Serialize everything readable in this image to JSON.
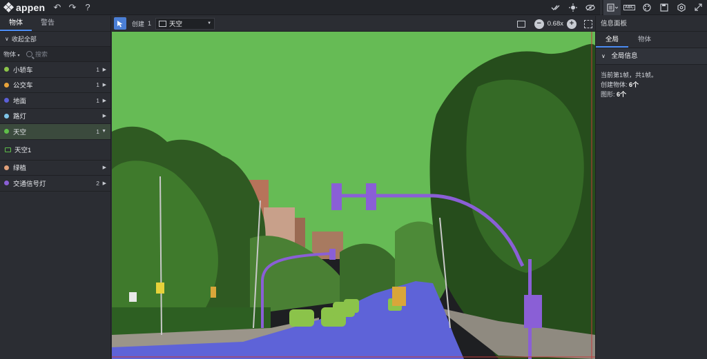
{
  "app": {
    "brand": "appen"
  },
  "topbar": {
    "undo": "↶",
    "redo": "↷",
    "help": "?",
    "right_icons": [
      "check-all-icon",
      "target-icon",
      "eye-icon",
      "layout-icon",
      "abc-icon",
      "palette-icon",
      "save-icon",
      "settings-icon",
      "expand-icon"
    ],
    "abc_label": "ABC"
  },
  "left": {
    "tabs": [
      {
        "label": "物体"
      },
      {
        "label": "警告"
      }
    ],
    "collapse_all": "收起全部",
    "filter_select": "物体",
    "search_placeholder": "搜索",
    "classes": [
      {
        "name": "小轿车",
        "color": "#8bc34a",
        "count": "1"
      },
      {
        "name": "公交车",
        "color": "#e8a33a",
        "count": "1"
      },
      {
        "name": "地面",
        "color": "#5b5fd6",
        "count": "1"
      },
      {
        "name": "路灯",
        "color": "#7fc4e8",
        "count": ""
      },
      {
        "name": "天空",
        "color": "#5fbf4a",
        "count": "1"
      },
      {
        "name": "绿植",
        "color": "#e0a07a",
        "count": ""
      },
      {
        "name": "交通信号灯",
        "color": "#8a5fd6",
        "count": "2"
      }
    ],
    "expanded_object": "天空1"
  },
  "canvasbar": {
    "create_label": "创建",
    "create_num": "1",
    "class_selected": "天空",
    "zoom": "0.68x",
    "zoom_minus": "−",
    "zoom_plus": "+"
  },
  "right": {
    "title": "信息面板",
    "tabs": [
      {
        "label": "全局"
      },
      {
        "label": "物体"
      }
    ],
    "section": "全局信息",
    "frame_text": "当前第1帧，共1帧。",
    "objects_label": "创建物体:",
    "objects_value": "6个",
    "shapes_label": "图形:",
    "shapes_value": "6个"
  },
  "colors": {
    "sky": "#66bb55",
    "ground": "#5e63d8",
    "signal": "#8a5fd6",
    "car": "#8bc34a",
    "bus": "#d9a63a",
    "accent": "#4d8ef7"
  }
}
